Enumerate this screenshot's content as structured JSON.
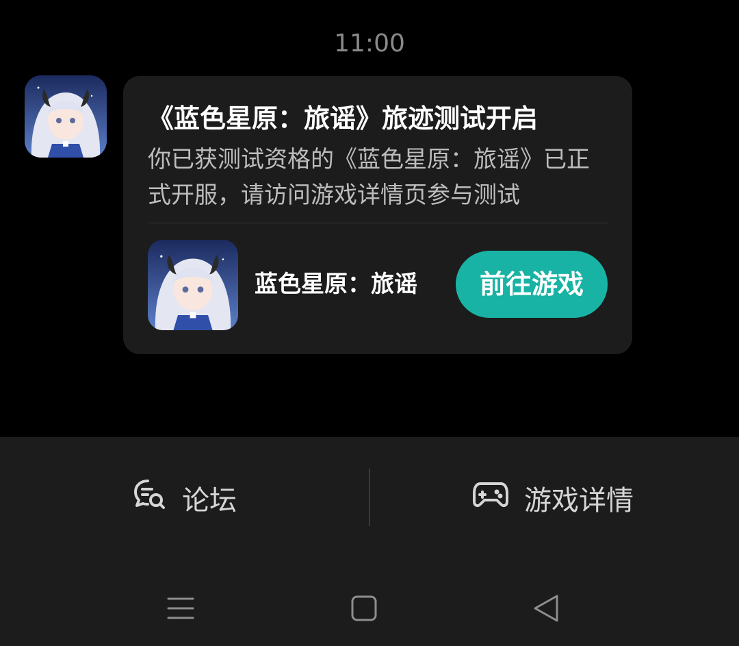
{
  "timestamp": "11:00",
  "message": {
    "title": "《蓝色星原：旅谣》旅迹测试开启",
    "body": "你已获测试资格的《蓝色星原：旅谣》已正式开服，请访问游戏详情页参与测试",
    "game": {
      "name": "蓝色星原：旅谣",
      "button_label": "前往游戏"
    }
  },
  "bottom_bar": {
    "forum_label": "论坛",
    "details_label": "游戏详情"
  },
  "nav": {
    "items": [
      "menu-icon",
      "home-icon",
      "back-icon"
    ]
  },
  "colors": {
    "accent": "#18b3a4",
    "card_bg": "#1c1c1c",
    "screen_bg": "#000000"
  }
}
